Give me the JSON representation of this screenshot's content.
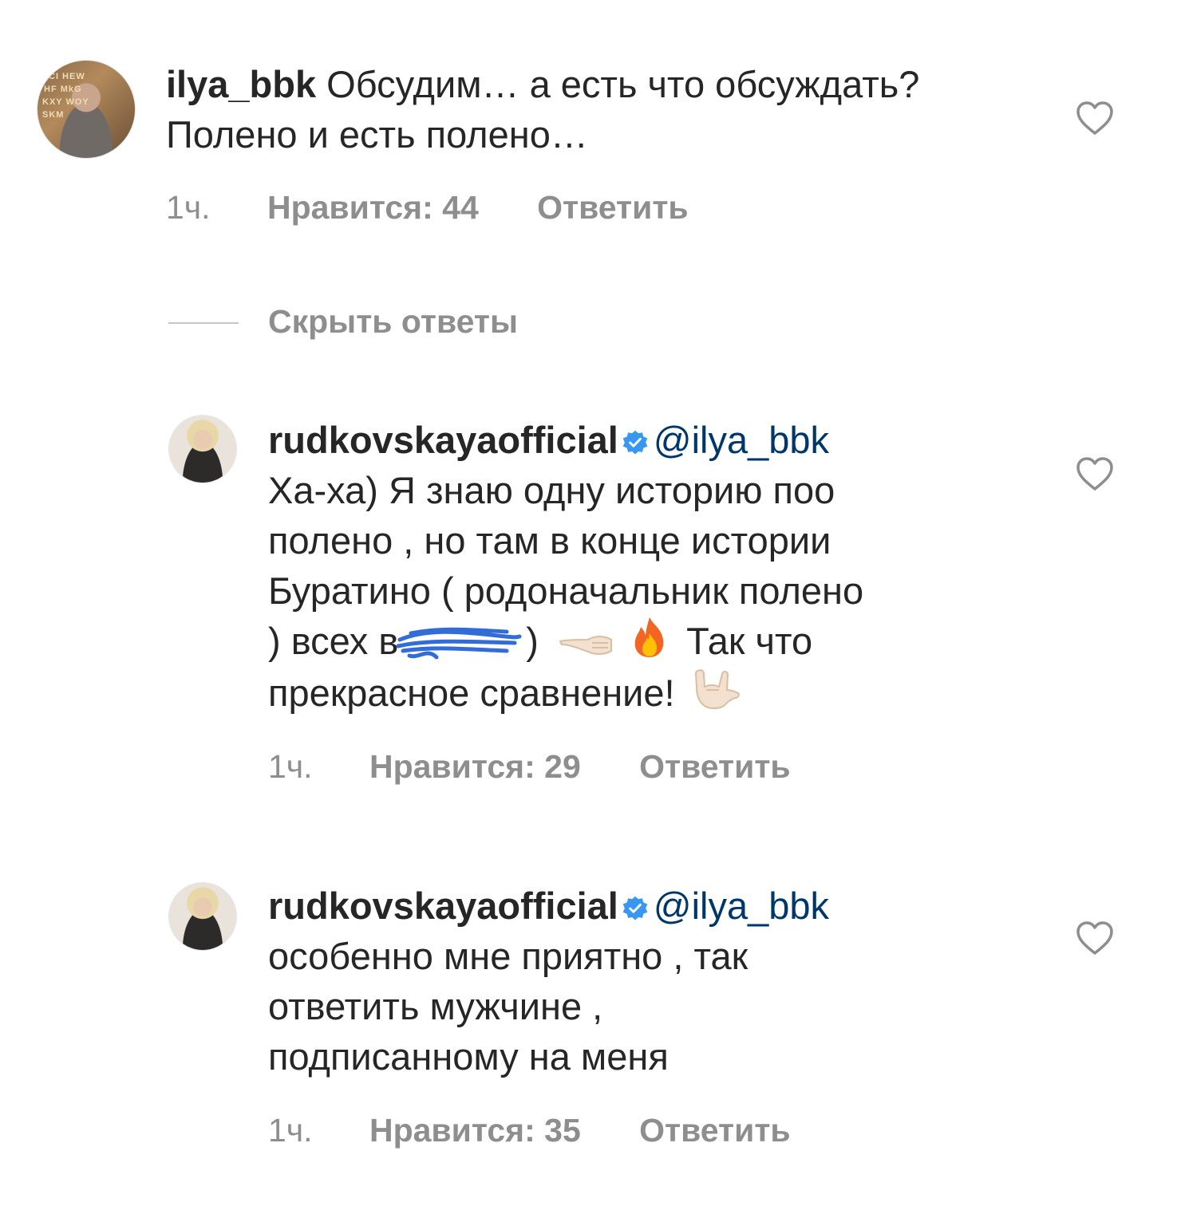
{
  "comments": [
    {
      "username": "ilya_bbk",
      "text": " Обсудим… а есть что обсуждать? Полено и есть полено…",
      "time": "1ч.",
      "likes": "Нравится: 44",
      "reply": "Ответить"
    },
    {
      "username": "rudkovskayaofficial",
      "mention": "@ilya_bbk",
      "line1": "Ха-ха) Я знаю одну историю поо",
      "line2": "полено , но там в конце истории",
      "line3": "Буратино ( родоначальник полено",
      "line4a": ") всех в",
      "line4b": ")",
      "line4c": "Так что",
      "line5": "прекрасное сравнение!",
      "time": "1ч.",
      "likes": "Нравится: 29",
      "reply": "Ответить"
    },
    {
      "username": "rudkovskayaofficial",
      "mention": "@ilya_bbk",
      "line1": "особенно мне приятно , так",
      "line2": "ответить мужчине ,",
      "line3": "подписанному на меня",
      "time": "1ч.",
      "likes": "Нравится: 35",
      "reply": "Ответить"
    }
  ],
  "hide_replies": "Скрыть ответы",
  "icons": {
    "like": "heart-outline-icon",
    "verified": "verified-badge-icon",
    "emoji1": "pointing-left-hand-emoji",
    "emoji2": "fire-emoji",
    "emoji3": "rock-on-hand-emoji"
  },
  "colors": {
    "text": "#262626",
    "meta": "#8e8e8e",
    "mention": "#00376b",
    "verified": "#3897f0",
    "redaction": "#1f5fd6"
  }
}
